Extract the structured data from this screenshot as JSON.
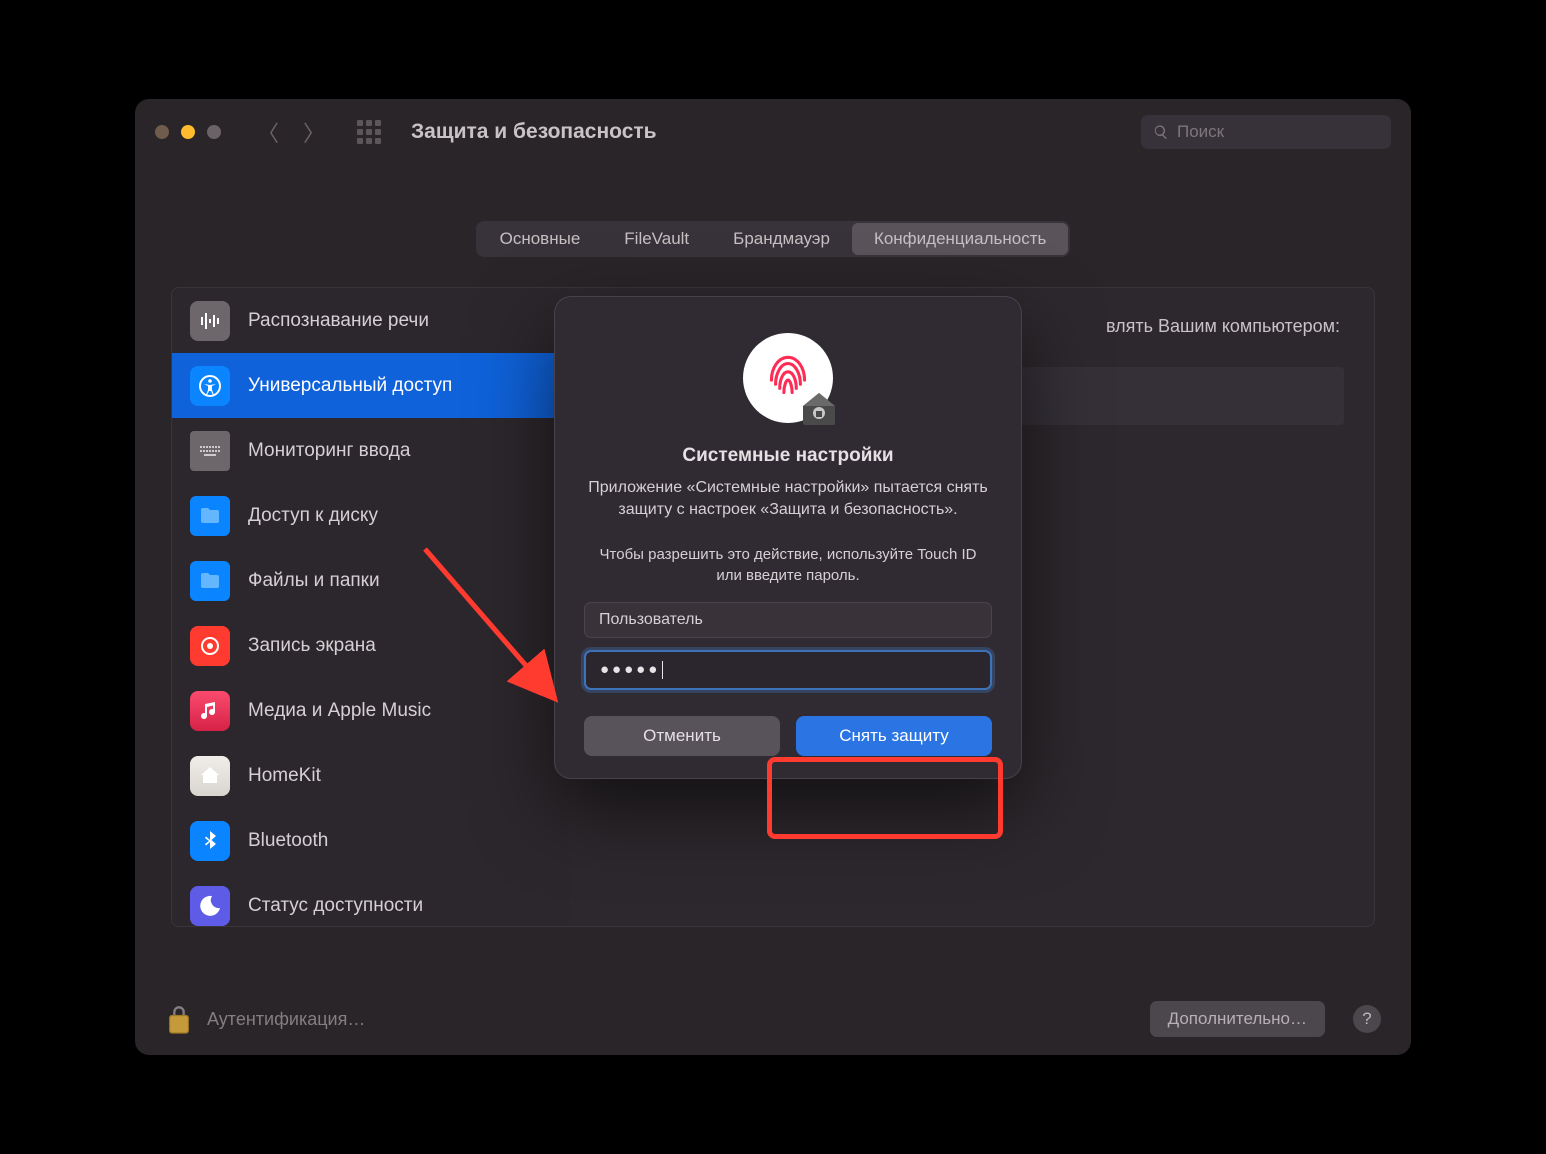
{
  "window_title": "Защита и безопасность",
  "search_placeholder": "Поиск",
  "tabs": {
    "general": "Основные",
    "filevault": "FileVault",
    "firewall": "Брандмауэр",
    "privacy": "Конфиденциальность"
  },
  "sidebar": {
    "items": [
      {
        "label": "Распознавание речи"
      },
      {
        "label": "Универсальный доступ"
      },
      {
        "label": "Мониторинг ввода"
      },
      {
        "label": "Доступ к диску"
      },
      {
        "label": "Файлы и папки"
      },
      {
        "label": "Запись экрана"
      },
      {
        "label": "Медиа и Apple Music"
      },
      {
        "label": "HomeKit"
      },
      {
        "label": "Bluetooth"
      },
      {
        "label": "Статус доступности"
      }
    ]
  },
  "main": {
    "heading_fragment": "влять Вашим компьютером:"
  },
  "lock": {
    "status": "Аутентификация…",
    "advanced": "Дополнительно…",
    "help": "?"
  },
  "dialog": {
    "title": "Системные настройки",
    "message": "Приложение «Системные настройки» пытается снять защиту с настроек «Защита и безопасность».",
    "instruction": "Чтобы разрешить это действие, используйте Touch ID или введите пароль.",
    "username": "Пользователь",
    "password_dots": "●●●●●",
    "cancel": "Отменить",
    "unlock": "Снять защиту"
  }
}
